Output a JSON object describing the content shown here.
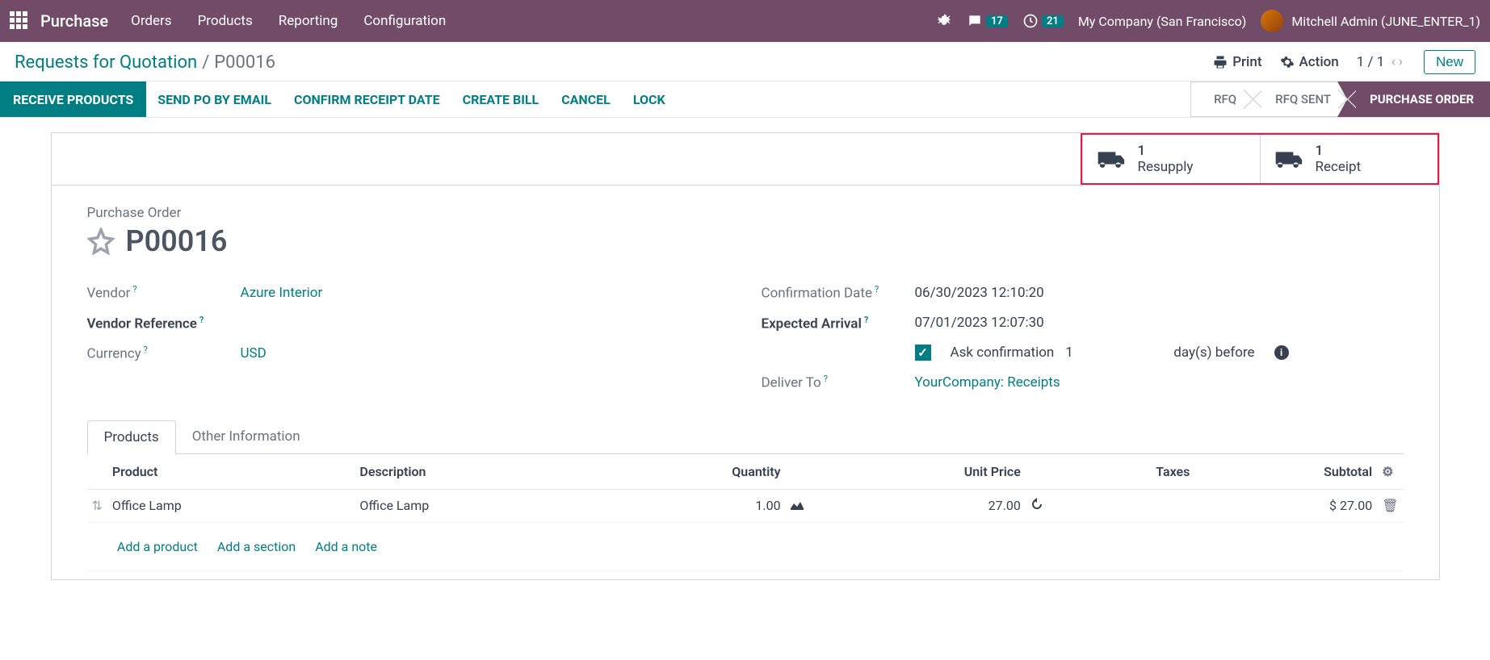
{
  "topnav": {
    "app": "Purchase",
    "menus": [
      "Orders",
      "Products",
      "Reporting",
      "Configuration"
    ],
    "messages_badge": "17",
    "activities_badge": "21",
    "company": "My Company (San Francisco)",
    "user": "Mitchell Admin (JUNE_ENTER_1)"
  },
  "breadcrumb": {
    "parent": "Requests for Quotation",
    "current": "P00016"
  },
  "cp": {
    "print": "Print",
    "action": "Action",
    "pager": "1 / 1",
    "new": "New"
  },
  "actions": {
    "receive": "RECEIVE PRODUCTS",
    "send": "SEND PO BY EMAIL",
    "confirm_date": "CONFIRM RECEIPT DATE",
    "bill": "CREATE BILL",
    "cancel": "CANCEL",
    "lock": "LOCK"
  },
  "status": {
    "rfq": "RFQ",
    "sent": "RFQ SENT",
    "po": "PURCHASE ORDER"
  },
  "stat": {
    "resupply_n": "1",
    "resupply": "Resupply",
    "receipt_n": "1",
    "receipt": "Receipt"
  },
  "sheet": {
    "label": "Purchase Order",
    "name": "P00016",
    "vendor_label": "Vendor",
    "vendor": "Azure Interior",
    "vref_label": "Vendor Reference",
    "currency_label": "Currency",
    "currency": "USD",
    "conf_label": "Confirmation Date",
    "conf": "06/30/2023 12:10:20",
    "arr_label": "Expected Arrival",
    "arr": "07/01/2023 12:07:30",
    "ask_label": "Ask confirmation",
    "ask_days": "1",
    "days_before": "day(s) before",
    "deliver_label": "Deliver To",
    "deliver": "YourCompany: Receipts"
  },
  "tabs": {
    "products": "Products",
    "other": "Other Information"
  },
  "table": {
    "h_product": "Product",
    "h_desc": "Description",
    "h_qty": "Quantity",
    "h_price": "Unit Price",
    "h_tax": "Taxes",
    "h_sub": "Subtotal",
    "row": {
      "product": "Office Lamp",
      "desc": "Office Lamp",
      "qty": "1.00",
      "price": "27.00",
      "sub": "$ 27.00"
    },
    "add_product": "Add a product",
    "add_section": "Add a section",
    "add_note": "Add a note"
  }
}
